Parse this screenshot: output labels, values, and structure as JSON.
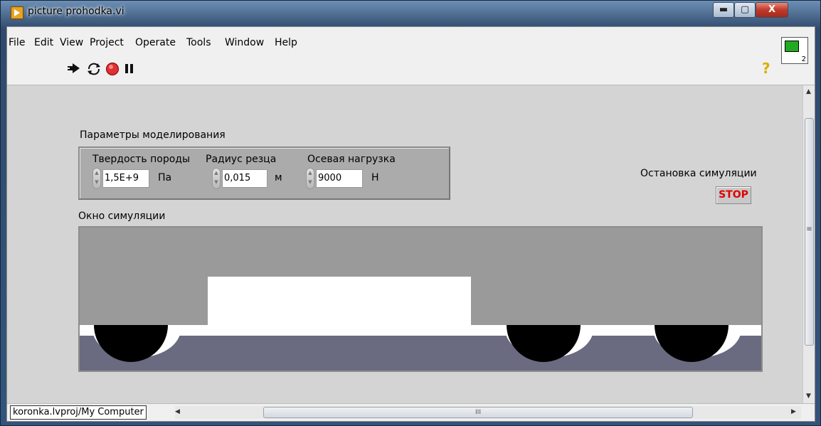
{
  "window": {
    "title": "picture prohodka.vi",
    "min": "▬",
    "max": "▢",
    "close": "X"
  },
  "menu": [
    "File",
    "Edit",
    "View",
    "Project",
    "Operate",
    "Tools",
    "Window",
    "Help"
  ],
  "toolbar": {
    "run_icon": "run-arrow-icon",
    "run_continuous_icon": "run-continuous-icon",
    "abort_icon": "abort-icon",
    "pause_icon": "pause-icon",
    "help_icon": "help-icon",
    "help_glyph": "?",
    "vi_icon_number": "2"
  },
  "panel": {
    "params_label": "Параметры моделирования",
    "controls": [
      {
        "label": "Твердость породы",
        "value": "1,5E+9",
        "unit": "Па"
      },
      {
        "label": "Радиус резца",
        "value": "0,015",
        "unit": "м"
      },
      {
        "label": "Осевая нагрузка",
        "value": "9000",
        "unit": "Н"
      }
    ],
    "stop_label": "Остановка симуляции",
    "stop_button": "STOP",
    "sim_label": "Окно симуляции",
    "colors": {
      "rock": "#6a6a80",
      "bit": "#9a9a9a",
      "hole": "#ffffff",
      "cutters": "#000000"
    }
  },
  "status": {
    "path": "koronka.lvproj/My Computer",
    "hscroll_grip": "III",
    "vscroll_grip": "≡"
  }
}
